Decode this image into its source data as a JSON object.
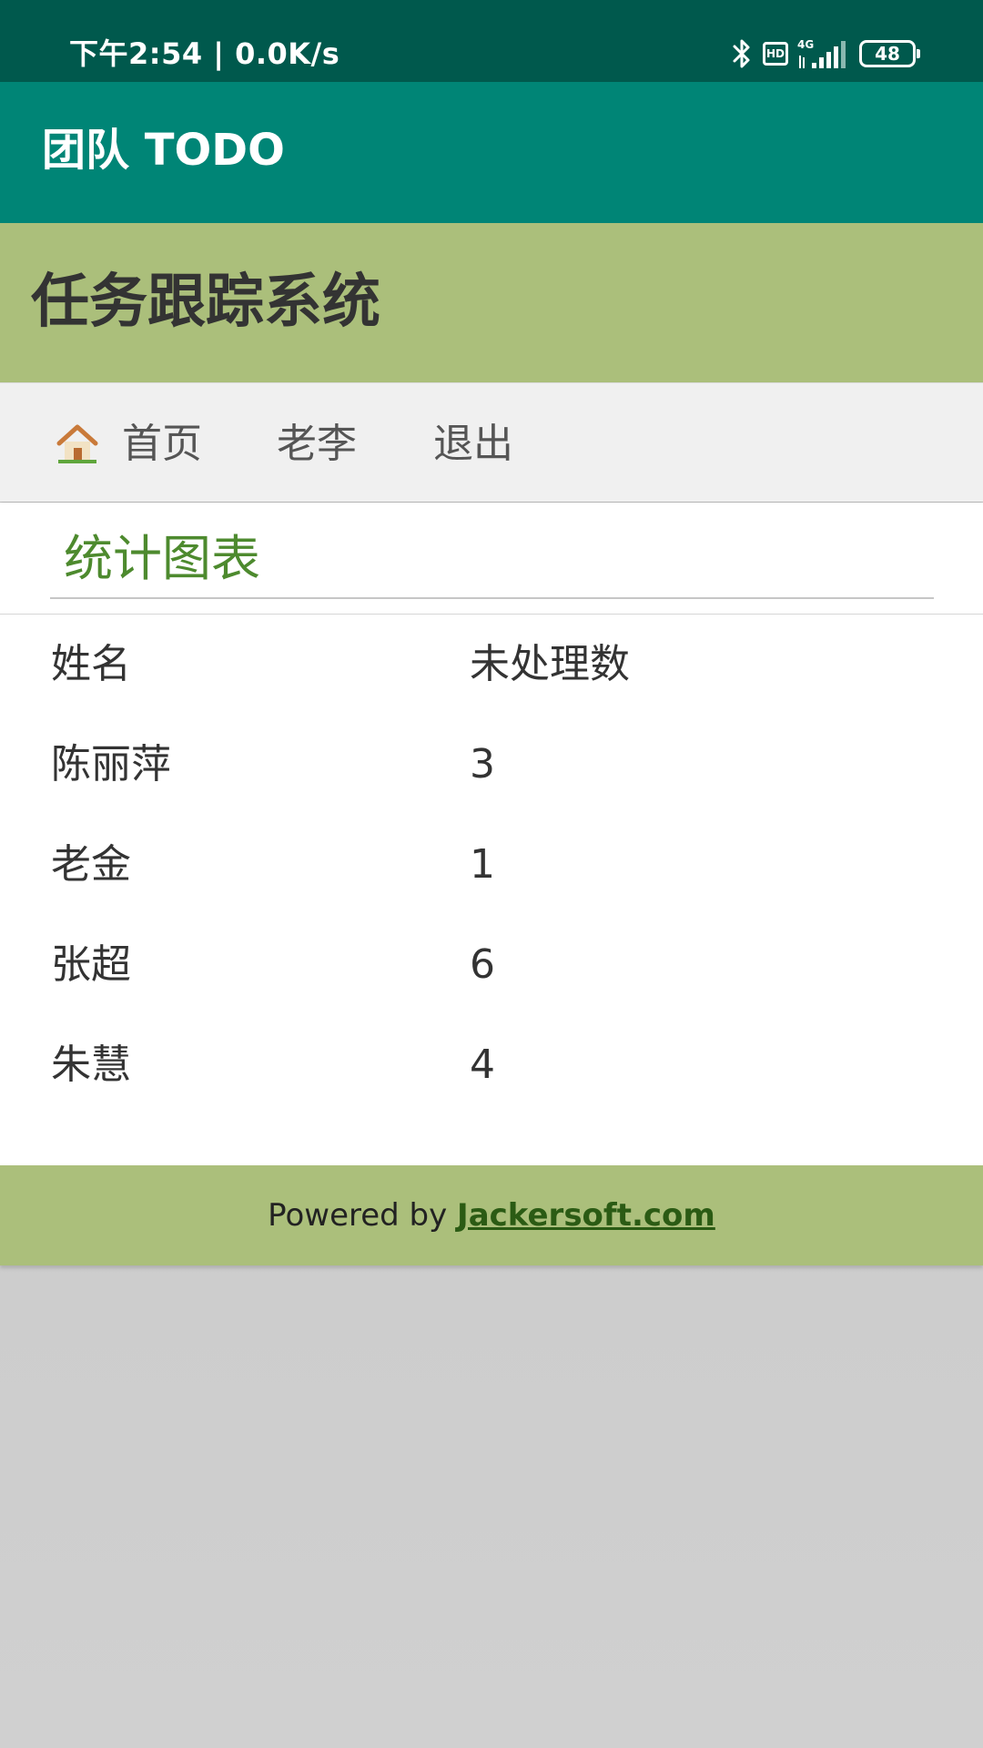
{
  "status_bar": {
    "time_speed": "下午2:54 | 0.0K/s",
    "hd": "HD",
    "network": "4G",
    "battery": "48"
  },
  "app_bar": {
    "title": "团队 TODO"
  },
  "site_header": {
    "title": "任务跟踪系统"
  },
  "nav": {
    "home": "首页",
    "user": "老李",
    "logout": "退出"
  },
  "section": {
    "title": "统计图表"
  },
  "table": {
    "headers": [
      "姓名",
      "未处理数"
    ],
    "rows": [
      {
        "name": "陈丽萍",
        "count": "3"
      },
      {
        "name": "老金",
        "count": "1"
      },
      {
        "name": "张超",
        "count": "6"
      },
      {
        "name": "朱慧",
        "count": "4"
      }
    ]
  },
  "footer": {
    "prefix": "Powered by ",
    "link": "Jackersoft.com"
  }
}
